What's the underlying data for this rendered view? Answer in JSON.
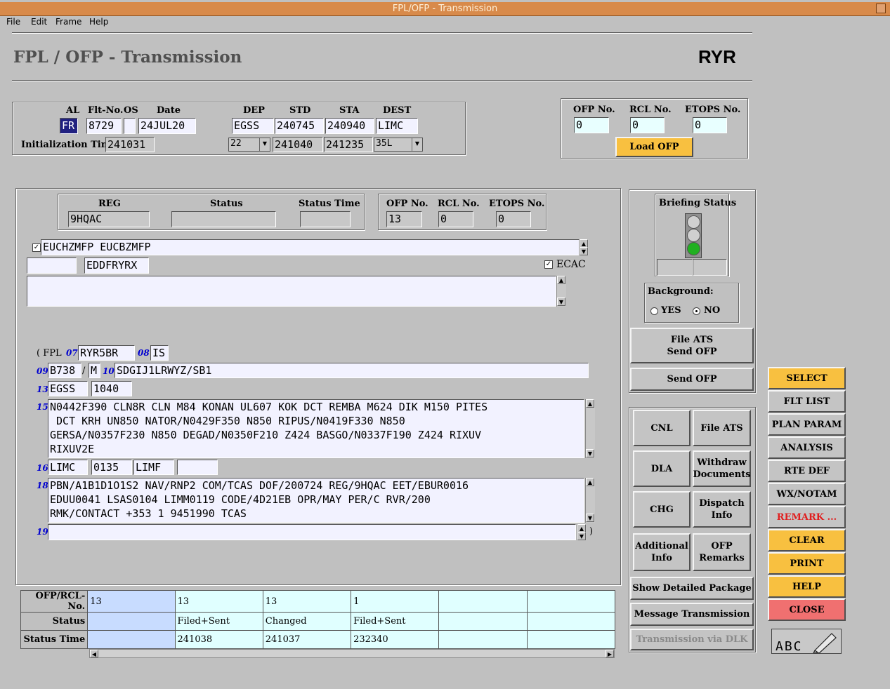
{
  "window": {
    "title": "FPL/OFP - Transmission"
  },
  "menu": [
    "File",
    "Edit",
    "Frame",
    "Help"
  ],
  "header": {
    "title": "FPL / OFP - Transmission",
    "airline_code": "RYR"
  },
  "flight": {
    "labels": {
      "al": "AL",
      "flt_no": "Flt-No.",
      "os": "OS",
      "date": "Date",
      "dep": "DEP",
      "std": "STD",
      "sta": "STA",
      "dest": "DEST",
      "init_time": "Initialization Time"
    },
    "al": "FR",
    "flt_no": "8729",
    "os": "",
    "date": "24JUL20",
    "dep": "EGSS",
    "std": "240745",
    "sta": "240940",
    "dest": "LIMC",
    "init_time": "241031",
    "rwy_dep": "22",
    "etd": "241040",
    "eta": "241235",
    "rwy_dest": "35L"
  },
  "ofp_top": {
    "labels": {
      "ofp": "OFP No.",
      "rcl": "RCL No.",
      "etops": "ETOPS No."
    },
    "ofp": "0",
    "rcl": "0",
    "etops": "0",
    "load_button": "Load OFP"
  },
  "aircraft": {
    "labels": {
      "reg": "REG",
      "status": "Status",
      "status_time": "Status Time"
    },
    "reg": "9HQAC",
    "status": "",
    "status_time": ""
  },
  "ofp_mid": {
    "labels": {
      "ofp": "OFP No.",
      "rcl": "RCL No.",
      "etops": "ETOPS No."
    },
    "ofp": "13",
    "rcl": "0",
    "etops": "0"
  },
  "addresses": {
    "line1": "EUCHZMFP EUCBZMFP",
    "line1_checked": "✓",
    "originator_prefix": "",
    "originator": "EDDFRYRX",
    "ecac_label": "ECAC",
    "ecac_checked": "✓"
  },
  "fpl": {
    "open": "( FPL",
    "n07": "07",
    "callsign": "RYR5BR",
    "n08": "08",
    "rules": "IS",
    "n09": "09",
    "type": "B738",
    "wake": "M",
    "n10": "10",
    "equip": "SDGIJ1LRWYZ/SB1",
    "n13": "13",
    "dep": "EGSS",
    "eobt": "1040",
    "n15": "15",
    "route": [
      "N0442F390 CLN8R CLN M84 KONAN UL607 KOK DCT REMBA M624 DIK M150 PITES",
      " DCT KRH UN850 NATOR/N0429F350 N850 RIPUS/N0419F330 N850",
      "GERSA/N0357F230 N850 DEGAD/N0350F210 Z424 BASGO/N0337F190 Z424 RIXUV",
      "RIXUV2E"
    ],
    "n16": "16",
    "dest": "LIMC",
    "eet": "0135",
    "altn": "LIMF",
    "altn2": "",
    "n18": "18",
    "other": [
      "PBN/A1B1D1O1S2 NAV/RNP2 COM/TCAS DOF/200724 REG/9HQAC EET/EBUR0016",
      "EDUU0041 LSAS0104 LIMM0119 CODE/4D21EB OPR/MAY PER/C RVR/200",
      "RMK/CONTACT +353 1 9451990 TCAS"
    ],
    "n19": "19",
    "close": ")"
  },
  "history": {
    "row_labels": [
      "OFP/RCL-No.",
      "Status",
      "Status Time"
    ],
    "cols": [
      {
        "no": "13",
        "status": "",
        "time": ""
      },
      {
        "no": "13",
        "status": "Filed+Sent",
        "time": "241038"
      },
      {
        "no": "13",
        "status": "Changed",
        "time": "241037"
      },
      {
        "no": "1",
        "status": "Filed+Sent",
        "time": "232340"
      },
      {
        "no": "",
        "status": "",
        "time": ""
      },
      {
        "no": "",
        "status": "",
        "time": ""
      }
    ]
  },
  "briefing": {
    "title": "Briefing Status",
    "background_label": "Background:",
    "yes": "YES",
    "no": "NO",
    "colors": {
      "off": "#d0d0d0",
      "green": "#20b020"
    }
  },
  "actions": {
    "file_ats_send": "File ATS\nSend OFP",
    "send_ofp": "Send OFP",
    "cnl": "CNL",
    "file_ats": "File ATS",
    "dla": "DLA",
    "withdraw": "Withdraw\nDocuments",
    "chg": "CHG",
    "dispatch": "Dispatch\nInfo",
    "additional": "Additional\nInfo",
    "ofp_remarks": "OFP\nRemarks",
    "show_package": "Show Detailed Package",
    "message_tx": "Message Transmission",
    "tx_dlk": "Transmission via DLK"
  },
  "sidebar": [
    "SELECT",
    "FLT LIST",
    "PLAN PARAM",
    "ANALYSIS",
    "RTE DEF",
    "WX/NOTAM",
    "REMARK ...",
    "CLEAR",
    "PRINT",
    "HELP",
    "CLOSE"
  ],
  "abc_label": "ABC"
}
